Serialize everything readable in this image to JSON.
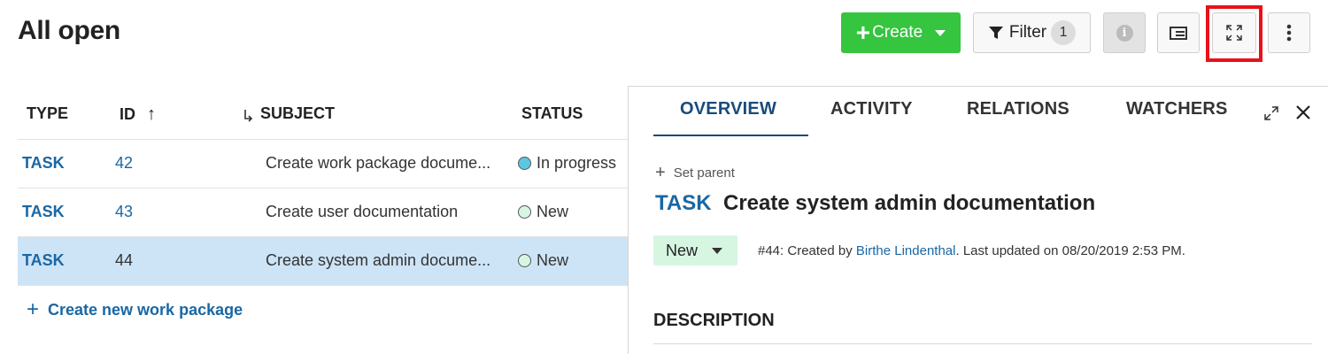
{
  "page": {
    "title": "All open"
  },
  "toolbar": {
    "create_label": "Create",
    "filter_label": "Filter",
    "filter_count": "1",
    "info_glyph": "i",
    "icons": [
      "plus-icon",
      "dropdown-caret-icon",
      "filter-funnel-icon",
      "info-icon",
      "split-view-icon",
      "fullscreen-icon",
      "more-vertical-icon"
    ],
    "create_color": "#35c53f",
    "highlight_color": "#e8111a"
  },
  "table": {
    "headers": {
      "type": "TYPE",
      "id": "ID",
      "id_sort": "↑",
      "subject": "SUBJECT",
      "status": "STATUS"
    },
    "rows": [
      {
        "type": "TASK",
        "id": "42",
        "subject": "Create work package docume...",
        "status": "In progress",
        "status_color": "#5bc8e0",
        "selected": false
      },
      {
        "type": "TASK",
        "id": "43",
        "subject": "Create user documentation",
        "status": "New",
        "status_color": "#d6f6e2",
        "selected": false
      },
      {
        "type": "TASK",
        "id": "44",
        "subject": "Create system admin docume...",
        "status": "New",
        "status_color": "#d6f6e2",
        "selected": true
      }
    ],
    "create_link": "Create new work package"
  },
  "detail": {
    "tabs": [
      "OVERVIEW",
      "ACTIVITY",
      "RELATIONS",
      "WATCHERS"
    ],
    "active_tab": "OVERVIEW",
    "set_parent": "Set parent",
    "type": "TASK",
    "subject": "Create system admin documentation",
    "status": "New",
    "meta_prefix": "#44: Created by ",
    "author": "Birthe Lindenthal",
    "meta_suffix": ". Last updated on 08/20/2019 2:53 PM.",
    "description_heading": "DESCRIPTION"
  }
}
